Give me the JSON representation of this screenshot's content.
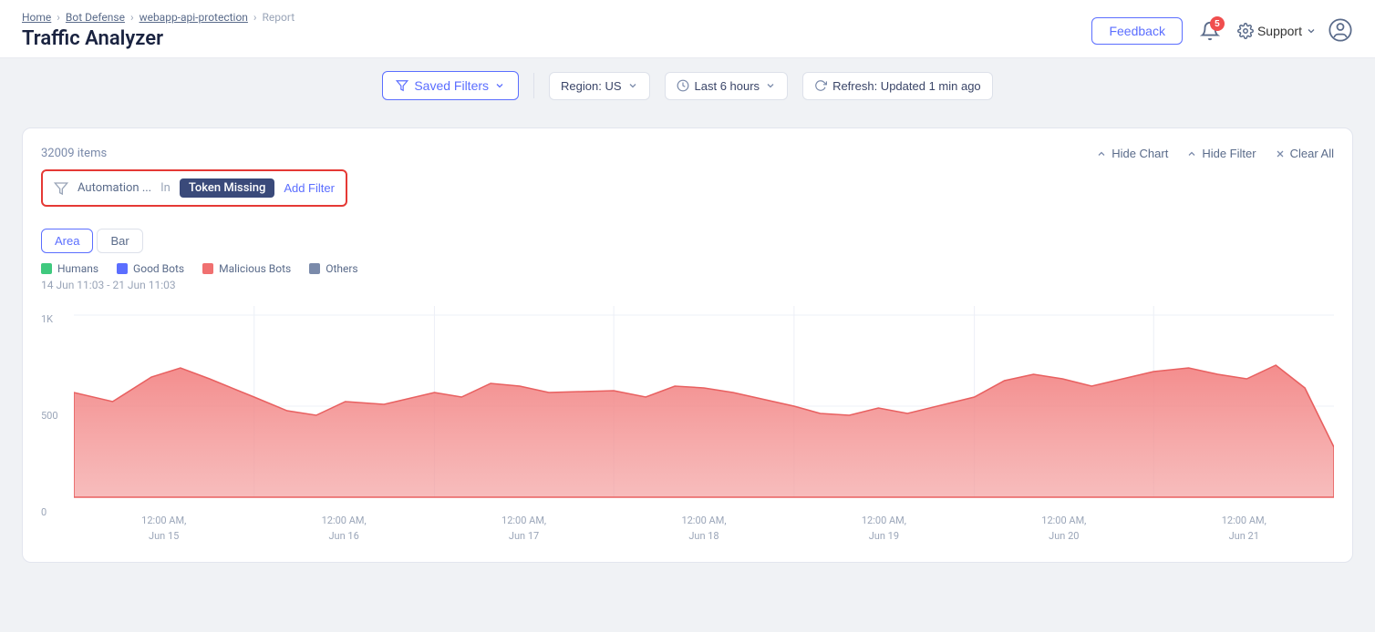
{
  "breadcrumb": {
    "items": [
      "Home",
      "Bot Defense",
      "webapp-api-protection",
      "Report"
    ]
  },
  "page": {
    "title": "Traffic Analyzer"
  },
  "header": {
    "feedback_label": "Feedback",
    "notif_count": "5",
    "support_label": "Support"
  },
  "toolbar": {
    "saved_filters_label": "Saved Filters",
    "region_label": "Region: US",
    "time_label": "Last 6 hours",
    "refresh_label": "Refresh: Updated 1 min ago"
  },
  "card": {
    "items_count": "32009 items",
    "filter": {
      "field": "Automation ...",
      "operator": "In",
      "value": "Token Missing",
      "add_label": "Add Filter"
    },
    "actions": {
      "hide_chart": "Hide Chart",
      "hide_filter": "Hide Filter",
      "clear_all": "Clear All"
    },
    "tabs": [
      "Area",
      "Bar"
    ],
    "active_tab": "Area",
    "legend": [
      {
        "label": "Humans",
        "color": "#3fc97e"
      },
      {
        "label": "Good Bots",
        "color": "#5b6eff"
      },
      {
        "label": "Malicious Bots",
        "color": "#f07070"
      },
      {
        "label": "Others",
        "color": "#7a8aaa"
      }
    ],
    "date_range": "14 Jun 11:03 - 21 Jun 11:03",
    "y_labels": [
      "1K",
      "500",
      "0"
    ],
    "x_labels": [
      {
        "line1": "12:00 AM,",
        "line2": "Jun 15"
      },
      {
        "line1": "12:00 AM,",
        "line2": "Jun 16"
      },
      {
        "line1": "12:00 AM,",
        "line2": "Jun 17"
      },
      {
        "line1": "12:00 AM,",
        "line2": "Jun 18"
      },
      {
        "line1": "12:00 AM,",
        "line2": "Jun 19"
      },
      {
        "line1": "12:00 AM,",
        "line2": "Jun 20"
      },
      {
        "line1": "12:00 AM,",
        "line2": "Jun 21"
      }
    ]
  }
}
